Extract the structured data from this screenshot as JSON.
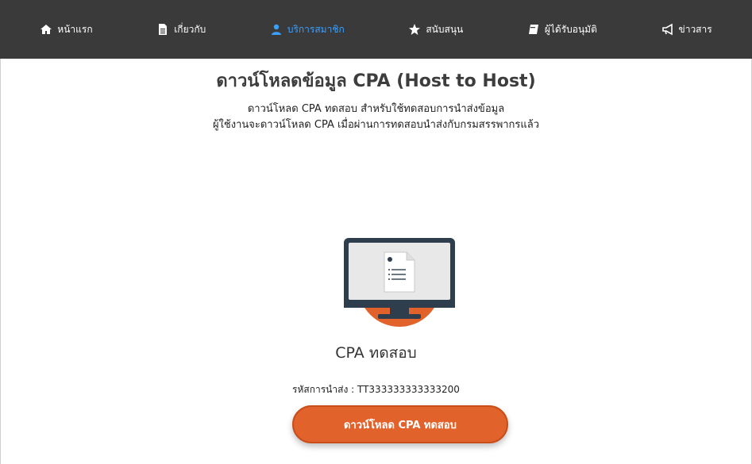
{
  "nav": {
    "items": [
      {
        "label": "หน้าแรก",
        "icon": "home-icon"
      },
      {
        "label": "เกี่ยวกับ",
        "icon": "document-icon"
      },
      {
        "label": "บริการสมาชิก",
        "icon": "user-icon",
        "active": true
      },
      {
        "label": "สนับสนุน",
        "icon": "star-icon"
      },
      {
        "label": "ผู้ได้รับอนุมัติ",
        "icon": "book-icon"
      },
      {
        "label": "ข่าวสาร",
        "icon": "megaphone-icon"
      }
    ],
    "background": "#3a3a3a",
    "active_color": "#3aa0ff"
  },
  "main": {
    "title": "ดาวน์โหลดข้อมูล CPA (Host to Host)",
    "desc_line1": "ดาวน์โหลด CPA ทดสอบ สำหรับใช้ทดสอบการนำส่งข้อมูล",
    "desc_line2": "ผู้ใช้งานจะดาวน์โหลด CPA เมื่อผ่านการทดสอบนำส่งกับกรมสรรพากรแล้ว",
    "card_title": "CPA ทดสอบ",
    "code_label": "รหัสการนำส่ง : TT333333333333200",
    "download_button": "ดาวน์โหลด CPA ทดสอบ",
    "accent": "#e2622b"
  }
}
